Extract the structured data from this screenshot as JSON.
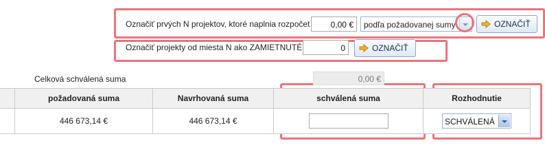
{
  "top_bar": {
    "label": "Označiť prvých N projektov, ktoré naplnia rozpočet",
    "budget_value": "0,00 €",
    "criterion_select": "podľa požadovanej sumy",
    "mark_button": "OZNAČIŤ"
  },
  "rejected_bar": {
    "label": "Označiť projekty od miesta N ako ZAMIETNUTÉ",
    "position_value": "0",
    "mark_button": "OZNAČIŤ"
  },
  "summary": {
    "label": "Celková schválená suma",
    "value": "0,00 €"
  },
  "table": {
    "headers": [
      "požadovaná suma",
      "Navrhovaná suma",
      "schválená suma",
      "Rozhodnutie"
    ],
    "row": {
      "requested": "446 673,14 €",
      "proposed": "446 673,14 €",
      "approved": "",
      "decision": "SCHVÁLENÁ"
    }
  },
  "colors": {
    "highlight": "#e8747c",
    "button_border": "#8aa6c6",
    "header_bg": "#f0f0f0",
    "arrow_icon": "#f0b429"
  },
  "icons": {
    "mark_button_icon": "arrow-right-icon",
    "dropdown_icon": "chevron-down-icon"
  }
}
